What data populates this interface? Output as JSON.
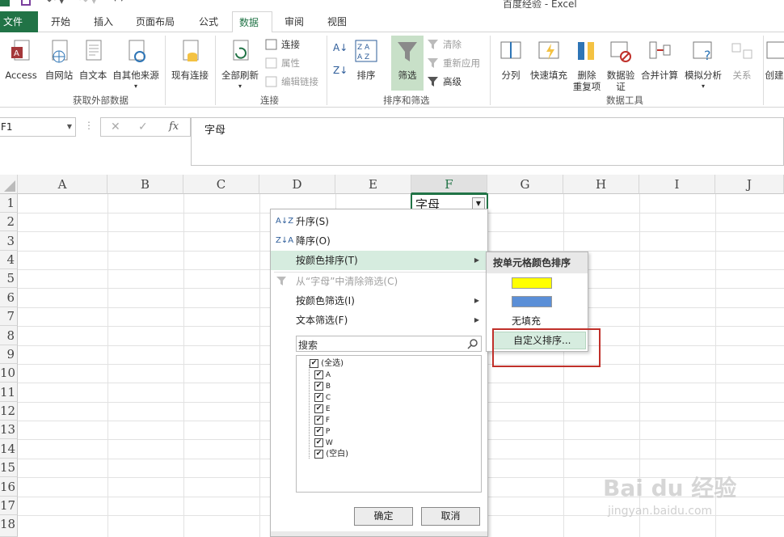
{
  "window": {
    "title": "百度经验 - Excel"
  },
  "tabs": [
    "开始",
    "插入",
    "页面布局",
    "公式",
    "数据",
    "审阅",
    "视图"
  ],
  "file_tab": "文件",
  "ribbon": {
    "access": "Access",
    "web": "自网站",
    "text": "自文本",
    "other": "自其他来源",
    "existing": "现有连接",
    "refresh_all": "全部刷新",
    "connections": "连接",
    "properties": "属性",
    "edit_links": "编辑链接",
    "sort": "排序",
    "filter": "筛选",
    "clear": "清除",
    "reapply": "重新应用",
    "advanced": "高级",
    "split": "分列",
    "flash_fill": "快速填充",
    "remove_dup_1": "删除",
    "remove_dup_2": "重复项",
    "validation_1": "数据验",
    "validation_2": "证",
    "consolidate": "合并计算",
    "whatif": "模拟分析",
    "relationships": "关系",
    "create": "创建",
    "group_get_external": "获取外部数据",
    "group_connections": "连接",
    "group_sort_filter": "排序和筛选",
    "group_data_tools": "数据工具"
  },
  "formula_bar": {
    "name_box": "F1",
    "content": "字母"
  },
  "columns": [
    "A",
    "B",
    "C",
    "D",
    "E",
    "F",
    "G",
    "H",
    "I",
    "J"
  ],
  "rows": [
    "1",
    "2",
    "3",
    "4",
    "5",
    "6",
    "7",
    "8",
    "9",
    "10",
    "11",
    "12",
    "13",
    "14",
    "15",
    "16",
    "17",
    "18"
  ],
  "cell_F1": "字母",
  "filter_menu": {
    "sort_asc": "升序(S)",
    "sort_desc": "降序(O)",
    "sort_by_color": "按颜色排序(T)",
    "clear_filter": "从“字母”中清除筛选(C)",
    "filter_by_color": "按颜色筛选(I)",
    "text_filters": "文本筛选(F)",
    "search_placeholder": "搜索",
    "items": [
      "(全选)",
      "A",
      "B",
      "C",
      "E",
      "F",
      "P",
      "W",
      "(空白)"
    ],
    "ok": "确定",
    "cancel": "取消"
  },
  "submenu": {
    "header": "按单元格颜色排序",
    "yellow": "#ffff00",
    "blue": "#5b8fd7",
    "no_fill": "无填充",
    "custom_sort": "自定义排序..."
  },
  "colors": {
    "excel_green": "#217346",
    "highlight": "#d6ecdf",
    "annotation_red": "#c0302a"
  },
  "watermark": {
    "brand": "Bai du 经验",
    "url": "jingyan.baidu.com"
  }
}
